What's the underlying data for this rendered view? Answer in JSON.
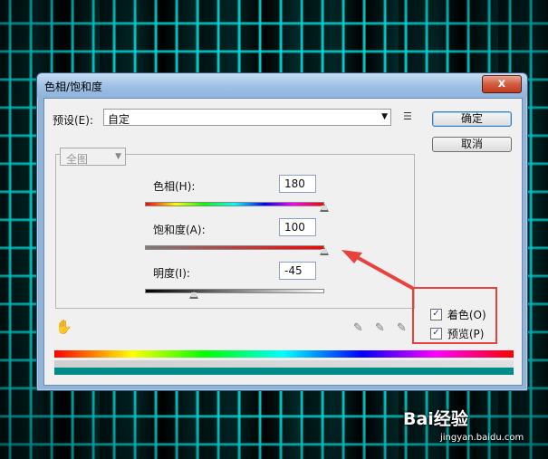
{
  "dialog": {
    "title": "色相/饱和度",
    "close_glyph": "x",
    "preset_label": "预设(E):",
    "preset_value": "自定",
    "ok_label": "确定",
    "cancel_label": "取消",
    "edit_value": "全图",
    "hue": {
      "label": "色相(H):",
      "value": "180",
      "min": -180,
      "max": 180
    },
    "saturation": {
      "label": "饱和度(A):",
      "value": "100",
      "min": -100,
      "max": 100
    },
    "lightness": {
      "label": "明度(I):",
      "value": "-45",
      "min": -100,
      "max": 100
    },
    "colorize": {
      "label": "着色(O)",
      "checked": true
    },
    "preview": {
      "label": "预览(P)",
      "checked": true
    },
    "result_color": "#008b8b"
  },
  "icons": {
    "hand": "targeted-adjustment-hand-icon",
    "eyedroppers": [
      "eyedropper-icon",
      "eyedropper-plus-icon",
      "eyedropper-minus-icon"
    ],
    "menu": "preset-options-icon"
  },
  "annotation": {
    "color": "#e8423f"
  },
  "watermark": {
    "text": "Bai经验",
    "sub": "jingyan.baidu.com"
  }
}
